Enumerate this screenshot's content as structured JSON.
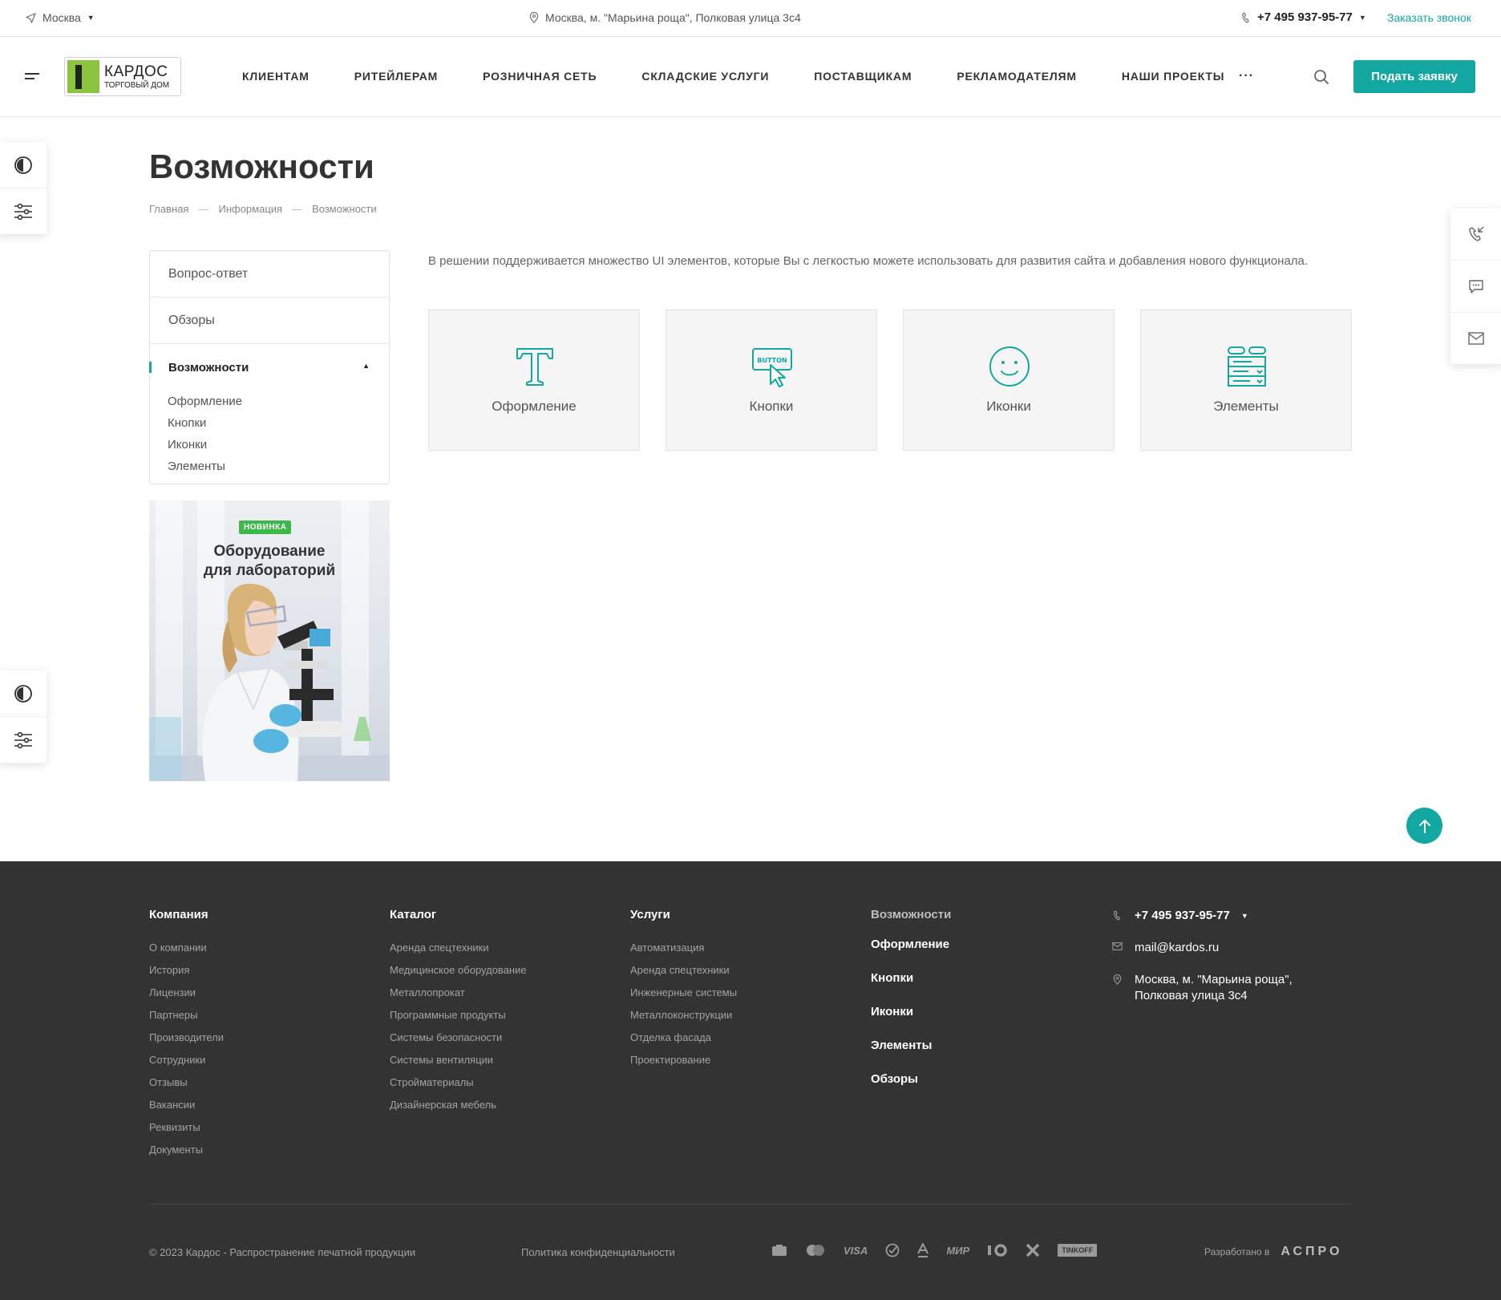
{
  "topbar": {
    "city": "Москва",
    "address": "Москва, м. \"Марьина роща\", Полковая улица 3с4",
    "phone": "+7 495 937-95-77",
    "callback": "Заказать звонок"
  },
  "header": {
    "logo_main": "КАРДОС",
    "logo_sub": "ТОРГОВЫЙ ДОМ",
    "nav": [
      "КЛИЕНТАМ",
      "РИТЕЙЛЕРАМ",
      "РОЗНИЧНАЯ СЕТЬ",
      "СКЛАДСКИЕ УСЛУГИ",
      "ПОСТАВЩИКАМ",
      "РЕКЛАМОДАТЕЛЯМ",
      "НАШИ ПРОЕКТЫ"
    ],
    "more": "···",
    "apply_button": "Подать заявку"
  },
  "page": {
    "title": "Возможности",
    "breadcrumb": [
      "Главная",
      "Информация",
      "Возможности"
    ],
    "breadcrumb_sep": "—",
    "intro": "В решении поддерживается множество UI элементов, которые Вы с легкостью можете использовать для развития сайта и добавления нового функционала."
  },
  "side_menu": {
    "items": [
      "Вопрос-ответ",
      "Обзоры",
      "Возможности"
    ],
    "subitems": [
      "Оформление",
      "Кнопки",
      "Иконки",
      "Элементы"
    ]
  },
  "promo": {
    "badge": "НОВИНКА",
    "title_line1": "Оборудование",
    "title_line2": "для лабораторий"
  },
  "tiles": [
    {
      "label": "Оформление",
      "icon": "typography-icon"
    },
    {
      "label": "Кнопки",
      "icon": "button-cursor-icon",
      "icon_text": "BUTTON"
    },
    {
      "label": "Иконки",
      "icon": "smiley-icon"
    },
    {
      "label": "Элементы",
      "icon": "form-elements-icon"
    }
  ],
  "colors": {
    "accent": "#12a7a0",
    "footer_bg": "#333333",
    "badge": "#3fb84b",
    "logo_green": "#8bc53f"
  },
  "footer": {
    "company": {
      "title": "Компания",
      "links": [
        "О компании",
        "История",
        "Лицензии",
        "Партнеры",
        "Производители",
        "Сотрудники",
        "Отзывы",
        "Вакансии",
        "Реквизиты",
        "Документы"
      ]
    },
    "catalog": {
      "title": "Каталог",
      "links": [
        "Аренда спецтехники",
        "Медицинское оборудование",
        "Металлопрокат",
        "Программные продукты",
        "Системы безопасности",
        "Системы вентиляции",
        "Стройматериалы",
        "Дизайнерская мебель"
      ]
    },
    "services": {
      "title": "Услуги",
      "links": [
        "Автоматизация",
        "Аренда спецтехники",
        "Инженерные системы",
        "Металлоконструкции",
        "Отделка фасада",
        "Проектирование"
      ]
    },
    "features": {
      "title": "Возможности",
      "links": [
        "Оформление",
        "Кнопки",
        "Иконки",
        "Элементы",
        "Обзоры"
      ]
    },
    "contacts": {
      "phone": "+7 495 937-95-77",
      "email": "mail@kardos.ru",
      "address_line1": "Москва, м. \"Марьина роща\",",
      "address_line2": "Полковая улица 3с4"
    },
    "copyright": "© 2023 Кардос - Распространение печатной продукции",
    "policy": "Политика конфиденциальности",
    "payments": [
      "VISA",
      "МИР",
      "TINKOFF"
    ],
    "developed_by": "Разработано в",
    "developer": "АСПРО"
  }
}
